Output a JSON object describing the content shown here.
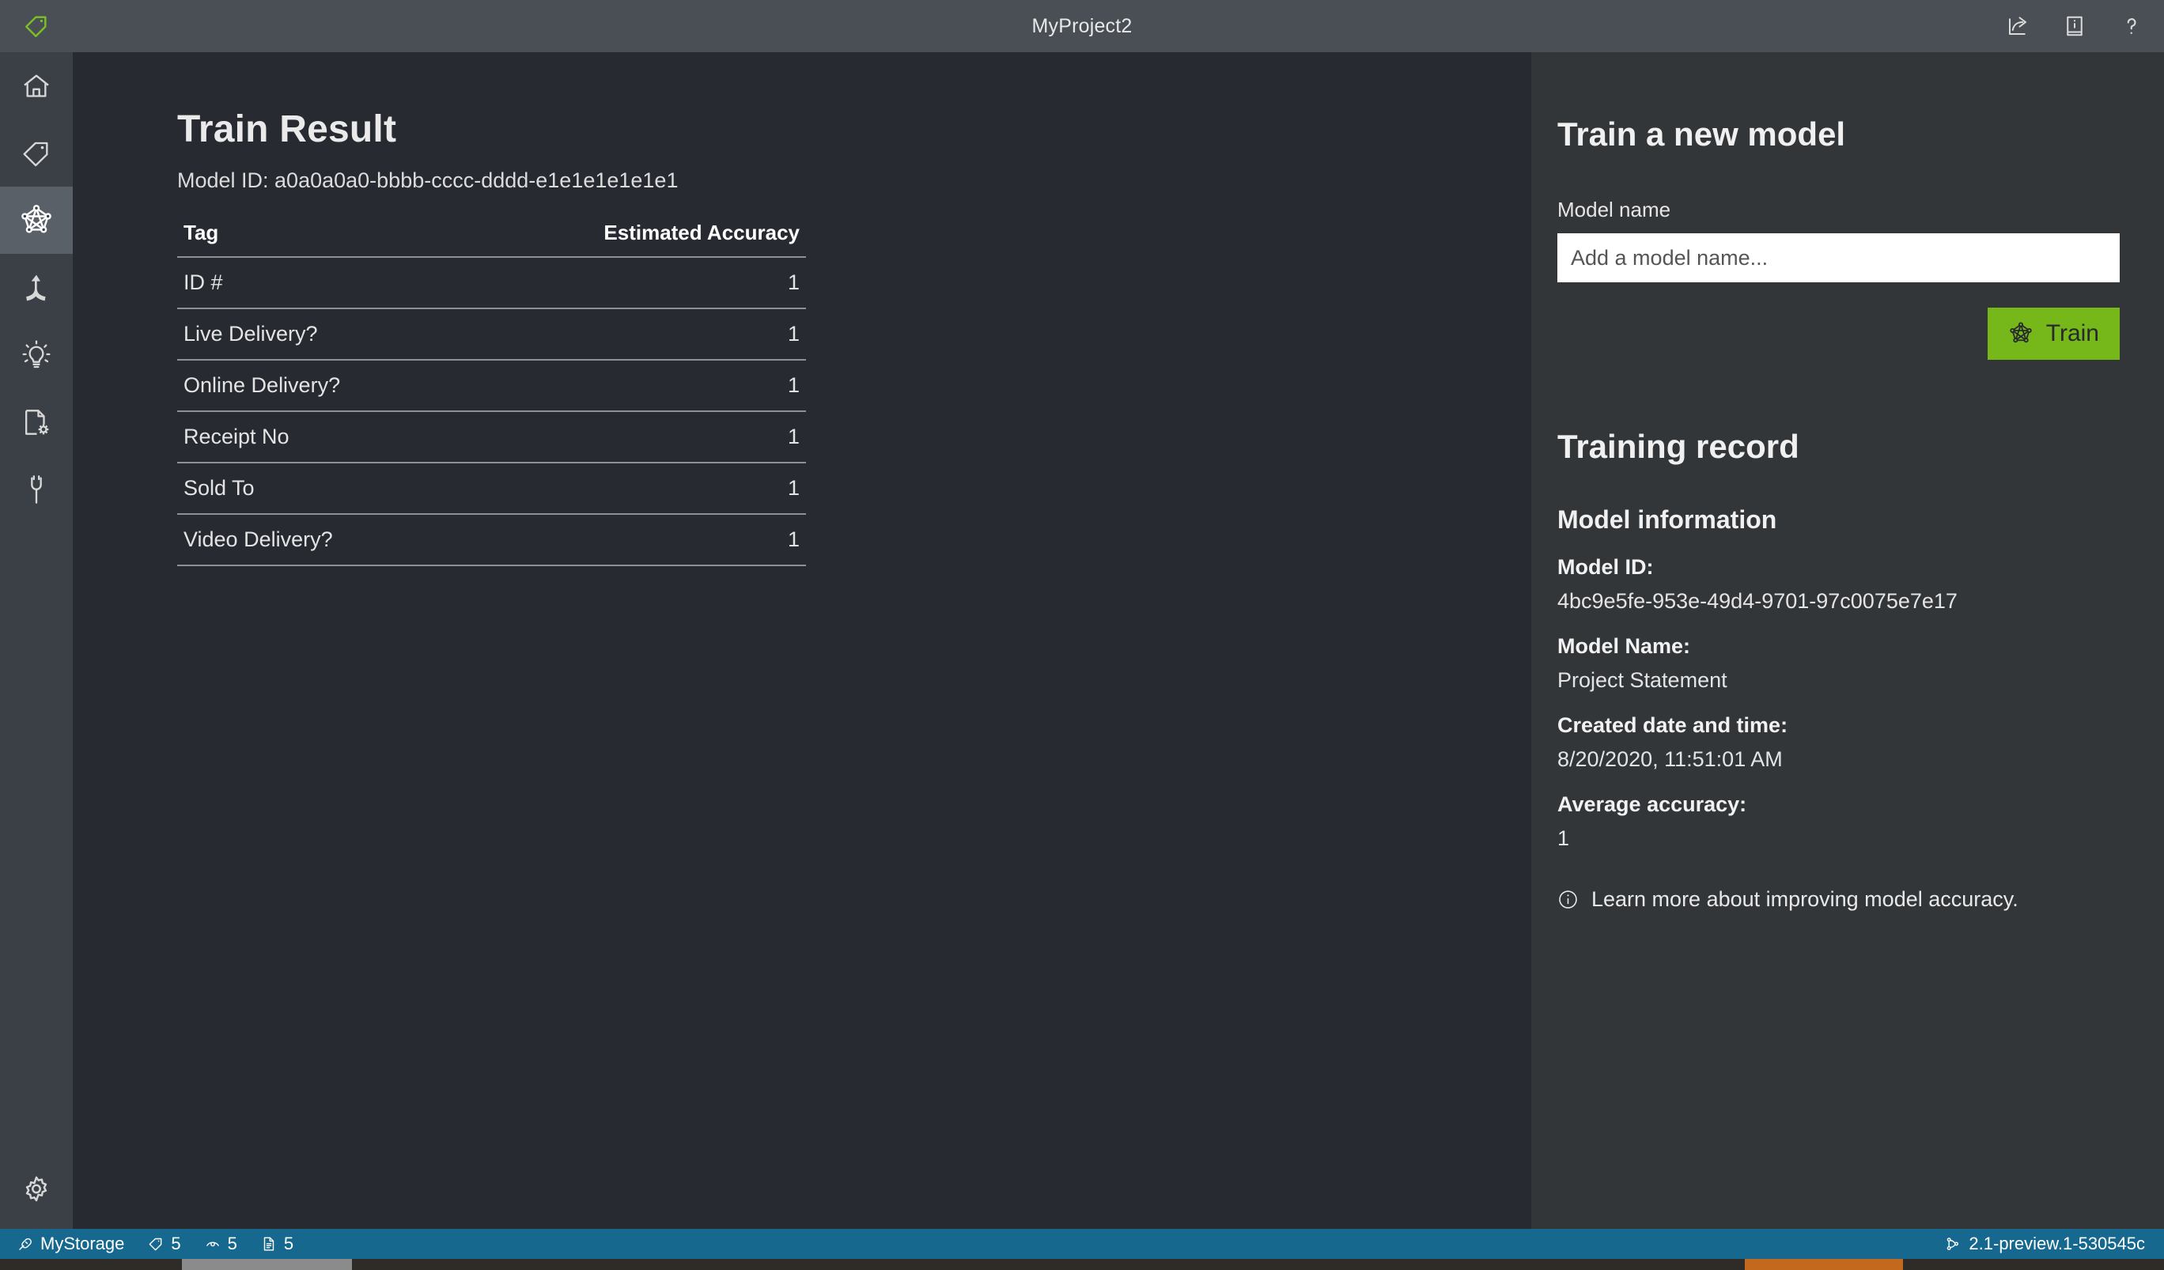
{
  "window": {
    "title": "MyProject2",
    "logo_icon": "tag-logo-icon",
    "actions": [
      {
        "name": "share-export-icon",
        "label": "Share"
      },
      {
        "name": "info-book-icon",
        "label": "Documentation"
      },
      {
        "name": "help-question-icon",
        "label": "Help"
      }
    ]
  },
  "sidebar": {
    "items": [
      {
        "name": "sidebar-item-home",
        "icon": "home-icon",
        "label": "Home",
        "active": false
      },
      {
        "name": "sidebar-item-tag",
        "icon": "tag-icon",
        "label": "Tag",
        "active": false
      },
      {
        "name": "sidebar-item-model",
        "icon": "model-network-icon",
        "label": "Train",
        "active": true
      },
      {
        "name": "sidebar-item-analyze",
        "icon": "merge-arrow-icon",
        "label": "Analyze",
        "active": false
      },
      {
        "name": "sidebar-item-predict",
        "icon": "lightbulb-icon",
        "label": "Predict",
        "active": false
      },
      {
        "name": "sidebar-item-document-settings",
        "icon": "document-gear-icon",
        "label": "Document settings",
        "active": false
      },
      {
        "name": "sidebar-item-connections",
        "icon": "plug-icon",
        "label": "Connections",
        "active": false
      }
    ],
    "bottom": {
      "name": "sidebar-item-settings",
      "icon": "gear-icon",
      "label": "Settings"
    }
  },
  "main": {
    "title": "Train Result",
    "model_id_line": "Model ID: a0a0a0a0-bbbb-cccc-dddd-e1e1e1e1e1e1",
    "table": {
      "columns": [
        "Tag",
        "Estimated Accuracy"
      ],
      "rows": [
        {
          "tag": "ID #",
          "accuracy": "1"
        },
        {
          "tag": "Live Delivery?",
          "accuracy": "1"
        },
        {
          "tag": "Online Delivery?",
          "accuracy": "1"
        },
        {
          "tag": "Receipt No",
          "accuracy": "1"
        },
        {
          "tag": "Sold To",
          "accuracy": "1"
        },
        {
          "tag": "Video Delivery?",
          "accuracy": "1"
        }
      ]
    }
  },
  "side": {
    "train_heading": "Train a new model",
    "model_name_label": "Model name",
    "model_name_value": "",
    "model_name_placeholder": "Add a model name...",
    "train_button_label": "Train",
    "train_button_icon": "model-network-icon",
    "train_button_color": "#76b71a",
    "training_record_heading": "Training record",
    "model_information_heading": "Model information",
    "fields": [
      {
        "label": "Model ID:",
        "value": "4bc9e5fe-953e-49d4-9701-97c0075e7e17"
      },
      {
        "label": "Model Name:",
        "value": "Project Statement"
      },
      {
        "label": "Created date and time:",
        "value": "8/20/2020, 11:51:01 AM"
      },
      {
        "label": "Average accuracy:",
        "value": "1"
      }
    ],
    "learn_more": {
      "icon": "info-circle-icon",
      "text": "Learn more about improving model accuracy."
    }
  },
  "statusbar": {
    "background": "#16688f",
    "connection": {
      "icon": "plug-icon",
      "label": "MyStorage"
    },
    "counts": [
      {
        "icon": "tag-icon",
        "value": "5"
      },
      {
        "icon": "eye-icon",
        "value": "5"
      },
      {
        "icon": "document-icon",
        "value": "5"
      }
    ],
    "version": {
      "icon": "branch-icon",
      "label": "2.1-preview.1-530545c"
    }
  }
}
